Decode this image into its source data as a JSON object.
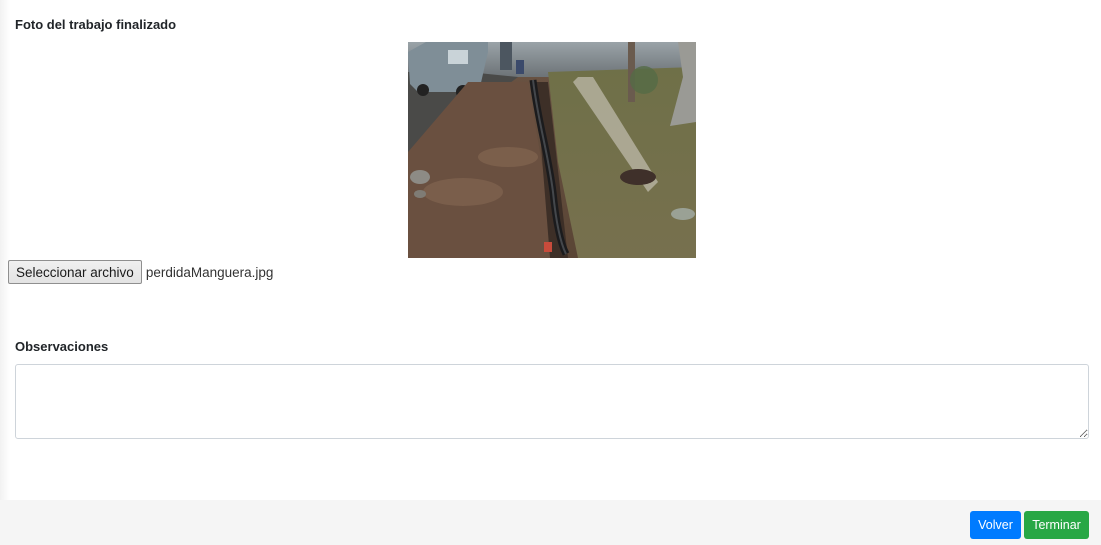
{
  "form": {
    "photo_label": "Foto del trabajo finalizado",
    "photo_alt": "trench with black pipe",
    "file_button_label": "Seleccionar archivo",
    "file_name": "perdidaManguera.jpg",
    "observations_label": "Observaciones",
    "observations_value": ""
  },
  "footer": {
    "back_label": "Volver",
    "finish_label": "Terminar"
  },
  "colors": {
    "primary": "#007bff",
    "success": "#28a745"
  }
}
